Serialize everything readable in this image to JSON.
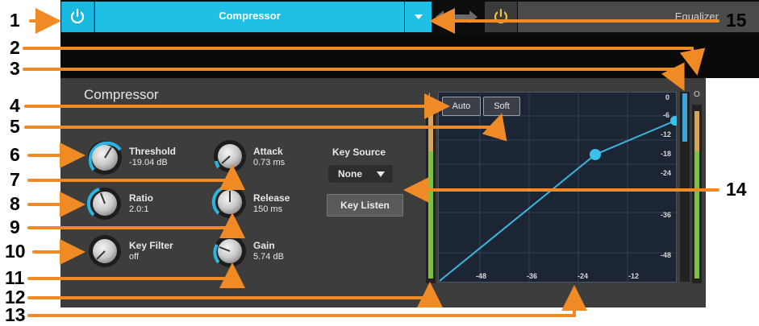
{
  "plugin": {
    "title": "Compressor",
    "panel_title": "Compressor",
    "next_plugin": "Equalizer"
  },
  "knobs": [
    {
      "label": "Threshold",
      "value": "-19.04 dB"
    },
    {
      "label": "Attack",
      "value": "0.73 ms"
    },
    {
      "label": "Ratio",
      "value": "2.0:1"
    },
    {
      "label": "Release",
      "value": "150 ms"
    },
    {
      "label": "Key Filter",
      "value": "off"
    },
    {
      "label": "Gain",
      "value": "5.74 dB"
    }
  ],
  "key_source": {
    "label": "Key Source",
    "value": "None",
    "listen_button": "Key Listen"
  },
  "graph": {
    "auto_button": "Auto",
    "soft_button": "Soft",
    "x_ticks": [
      "-48",
      "-36",
      "-24",
      "-12"
    ],
    "y_ticks": [
      "0",
      "-6",
      "-12",
      "-18",
      "-24",
      "-36",
      "-48"
    ]
  },
  "meters": {
    "input_label": "I",
    "output_label": "O"
  },
  "callouts": [
    "1",
    "2",
    "3",
    "4",
    "5",
    "6",
    "7",
    "8",
    "9",
    "10",
    "11",
    "12",
    "13",
    "14",
    "15"
  ],
  "colors": {
    "accent": "#1ec0e6",
    "callout_line": "#f08a24",
    "panel": "#3d3d3d",
    "graph_bg": "#1c2534",
    "meter_green": "#7ac043"
  }
}
